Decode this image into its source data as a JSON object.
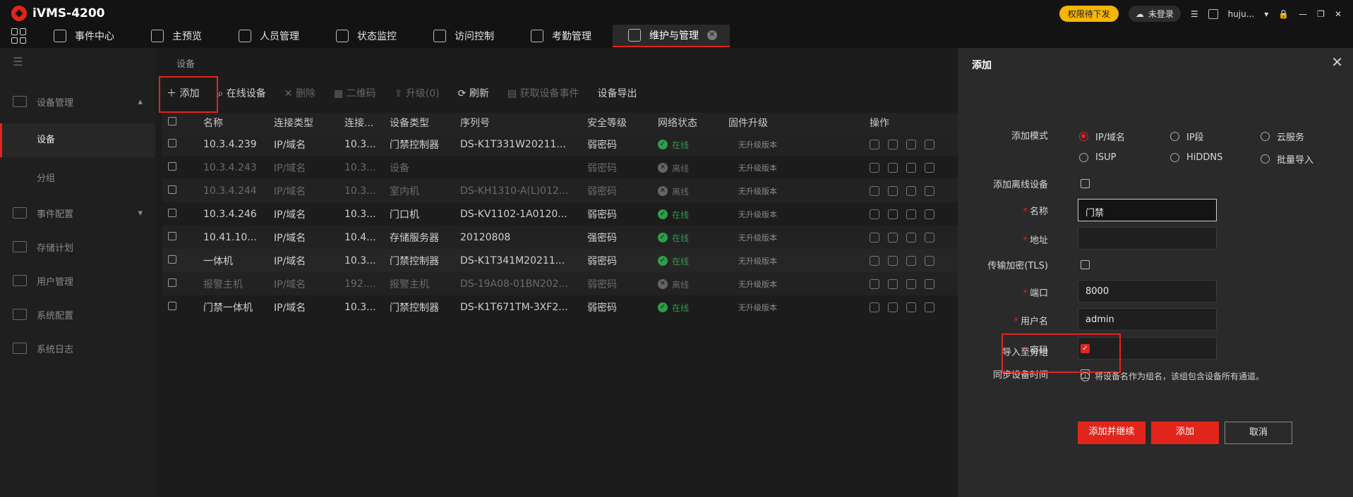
{
  "app": {
    "title": "iVMS-4200"
  },
  "topbar": {
    "upgrade": "权限待下发",
    "cloud": "未登录",
    "user": "huju..."
  },
  "nav": {
    "tabs": [
      "事件中心",
      "主预览",
      "人员管理",
      "状态监控",
      "访问控制",
      "考勤管理",
      "维护与管理"
    ]
  },
  "sidebar": {
    "group1": "设备管理",
    "sub1": "设备",
    "sub2": "分组",
    "item2": "事件配置",
    "item3": "存储计划",
    "item4": "用户管理",
    "item5": "系统配置",
    "item6": "系统日志"
  },
  "main": {
    "section_title": "设备",
    "toolbar": {
      "add": "添加",
      "online": "在线设备",
      "delete": "删除",
      "qr": "二维码",
      "upgrade": "升级(0)",
      "refresh": "刷新",
      "events": "获取设备事件",
      "export": "设备导出"
    },
    "columns": [
      "名称",
      "连接类型",
      "连接...",
      "设备类型",
      "序列号",
      "安全等级",
      "网络状态",
      "固件升级",
      "操作"
    ],
    "rows": [
      {
        "name": "10.3.4.239",
        "conn": "IP/域名",
        "addr": "10.3...",
        "type": "门禁控制器",
        "serial": "DS-K1T331W20211...",
        "sec": "弱密码",
        "status": "在线",
        "fw": "无升级版本",
        "online": true
      },
      {
        "name": "10.3.4.243",
        "conn": "IP/域名",
        "addr": "10.3...",
        "type": "设备",
        "serial": "",
        "sec": "弱密码",
        "status": "离线",
        "fw": "无升级版本",
        "online": false
      },
      {
        "name": "10.3.4.244",
        "conn": "IP/域名",
        "addr": "10.3...",
        "type": "室内机",
        "serial": "DS-KH1310-A(L)012...",
        "sec": "弱密码",
        "status": "离线",
        "fw": "无升级版本",
        "online": false
      },
      {
        "name": "10.3.4.246",
        "conn": "IP/域名",
        "addr": "10.3...",
        "type": "门口机",
        "serial": "DS-KV1102-1A0120...",
        "sec": "弱密码",
        "status": "在线",
        "fw": "无升级版本",
        "online": true
      },
      {
        "name": "10.41.10...",
        "conn": "IP/域名",
        "addr": "10.4...",
        "type": "存储服务器",
        "serial": "20120808",
        "sec": "强密码",
        "status": "在线",
        "fw": "无升级版本",
        "online": true
      },
      {
        "name": "一体机",
        "conn": "IP/域名",
        "addr": "10.3...",
        "type": "门禁控制器",
        "serial": "DS-K1T341M20211...",
        "sec": "弱密码",
        "status": "在线",
        "fw": "无升级版本",
        "online": true
      },
      {
        "name": "报警主机",
        "conn": "IP/域名",
        "addr": "192....",
        "type": "报警主机",
        "serial": "DS-19A08-01BN202...",
        "sec": "弱密码",
        "status": "离线",
        "fw": "无升级版本",
        "online": false
      },
      {
        "name": "门禁一体机",
        "conn": "IP/域名",
        "addr": "10.3...",
        "type": "门禁控制器",
        "serial": "DS-K1T671TM-3XF2...",
        "sec": "弱密码",
        "status": "在线",
        "fw": "无升级版本",
        "online": true
      }
    ]
  },
  "panel": {
    "title": "添加",
    "mode_label": "添加模式",
    "modes": [
      "IP/域名",
      "IP段",
      "云服务",
      "ISUP",
      "HiDDNS",
      "批量导入"
    ],
    "offline_label": "添加离线设备",
    "name_label": "名称",
    "name_value": "门禁",
    "addr_label": "地址",
    "addr_value": "",
    "tls_label": "传输加密(TLS)",
    "port_label": "端口",
    "port_value": "8000",
    "user_label": "用户名",
    "user_value": "admin",
    "pwd_label": "密码",
    "pwd_value": "",
    "sync_label": "同步设备时间",
    "import_label": "导入至分组",
    "hint": "将设备名作为组名，该组包含设备所有通道。",
    "btn_continue": "添加并继续",
    "btn_add": "添加",
    "btn_cancel": "取消"
  }
}
